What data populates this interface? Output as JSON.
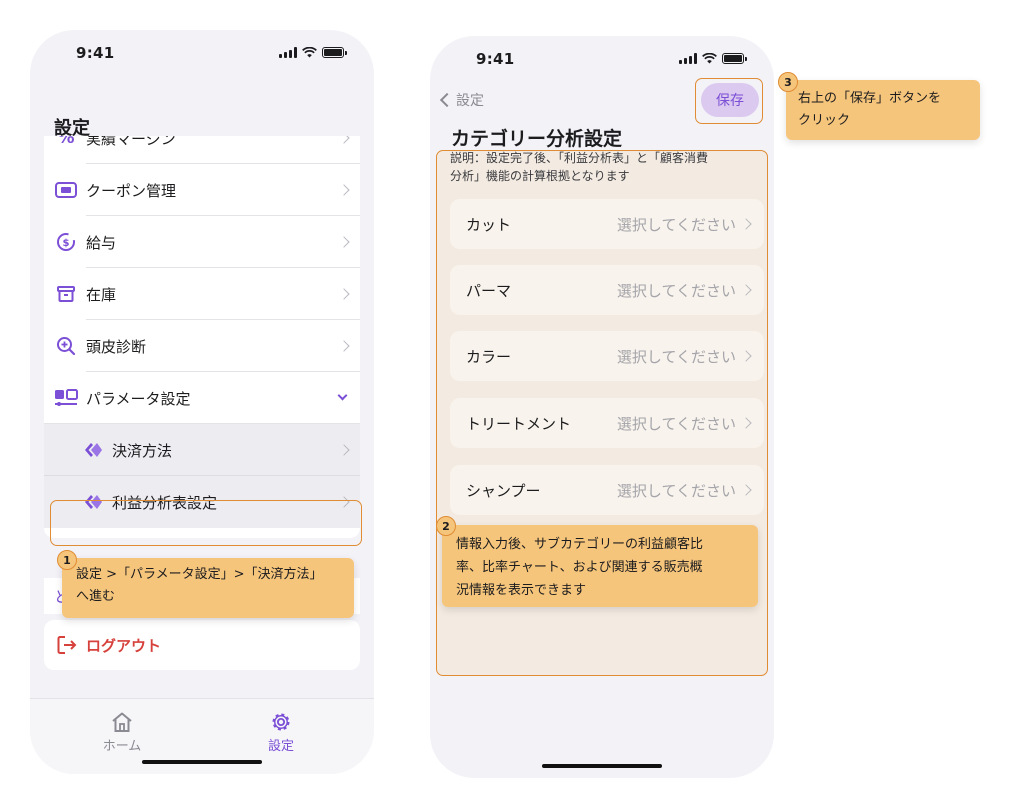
{
  "phone1": {
    "status": {
      "time": "9:41"
    },
    "title": "設定",
    "items": [
      {
        "label": "実績マージン",
        "icon": "percent-icon"
      },
      {
        "label": "クーポン管理",
        "icon": "coupon-icon"
      },
      {
        "label": "給与",
        "icon": "salary-icon"
      },
      {
        "label": "在庫",
        "icon": "inventory-box-icon"
      },
      {
        "label": "頭皮診断",
        "icon": "scalp-diagnosis-icon"
      },
      {
        "label": "パラメータ設定",
        "icon": "parameters-icon",
        "expanded": true
      },
      {
        "label": "決済方法",
        "icon": "payment-diamond-icon",
        "sub": true
      },
      {
        "label": "利益分析表設定",
        "icon": "profit-diamond-icon",
        "sub": true
      }
    ],
    "hidden_item_fragment": "と",
    "logout": {
      "label": "ログアウト",
      "icon": "logout-icon"
    },
    "tabbar": {
      "home": "ホーム",
      "settings": "設定"
    },
    "callout": {
      "number": "1",
      "text_line1": "設定 >「パラメータ設定」>「決済方法」",
      "text_line2": "へ進む"
    }
  },
  "phone2": {
    "status": {
      "time": "9:41"
    },
    "back_label": "設定",
    "save_label": "保存",
    "title": "カテゴリー分析設定",
    "description_line1": "説明：設定完了後、「利益分析表」と「顧客消費",
    "description_line2": "分析」機能の計算根拠となります",
    "categories": [
      {
        "label": "カット",
        "value": "選択してください"
      },
      {
        "label": "パーマ",
        "value": "選択してください"
      },
      {
        "label": "カラー",
        "value": "選択してください"
      },
      {
        "label": "トリートメント",
        "value": "選択してください"
      },
      {
        "label": "シャンプー",
        "value": "選択してください"
      }
    ],
    "callout2": {
      "number": "2",
      "line1": "情報入力後、サブカテゴリーの利益顧客比",
      "line2": "率、比率チャート、および関連する販売概",
      "line3": "況情報を表示できます"
    },
    "callout3": {
      "number": "3",
      "line1": "右上の「保存」ボタンを",
      "line2": "クリック"
    }
  },
  "colors": {
    "accent": "#7b4fd6",
    "callout": "#f6c57c",
    "highlight_border": "#df8c34",
    "logout": "#d6413b"
  }
}
